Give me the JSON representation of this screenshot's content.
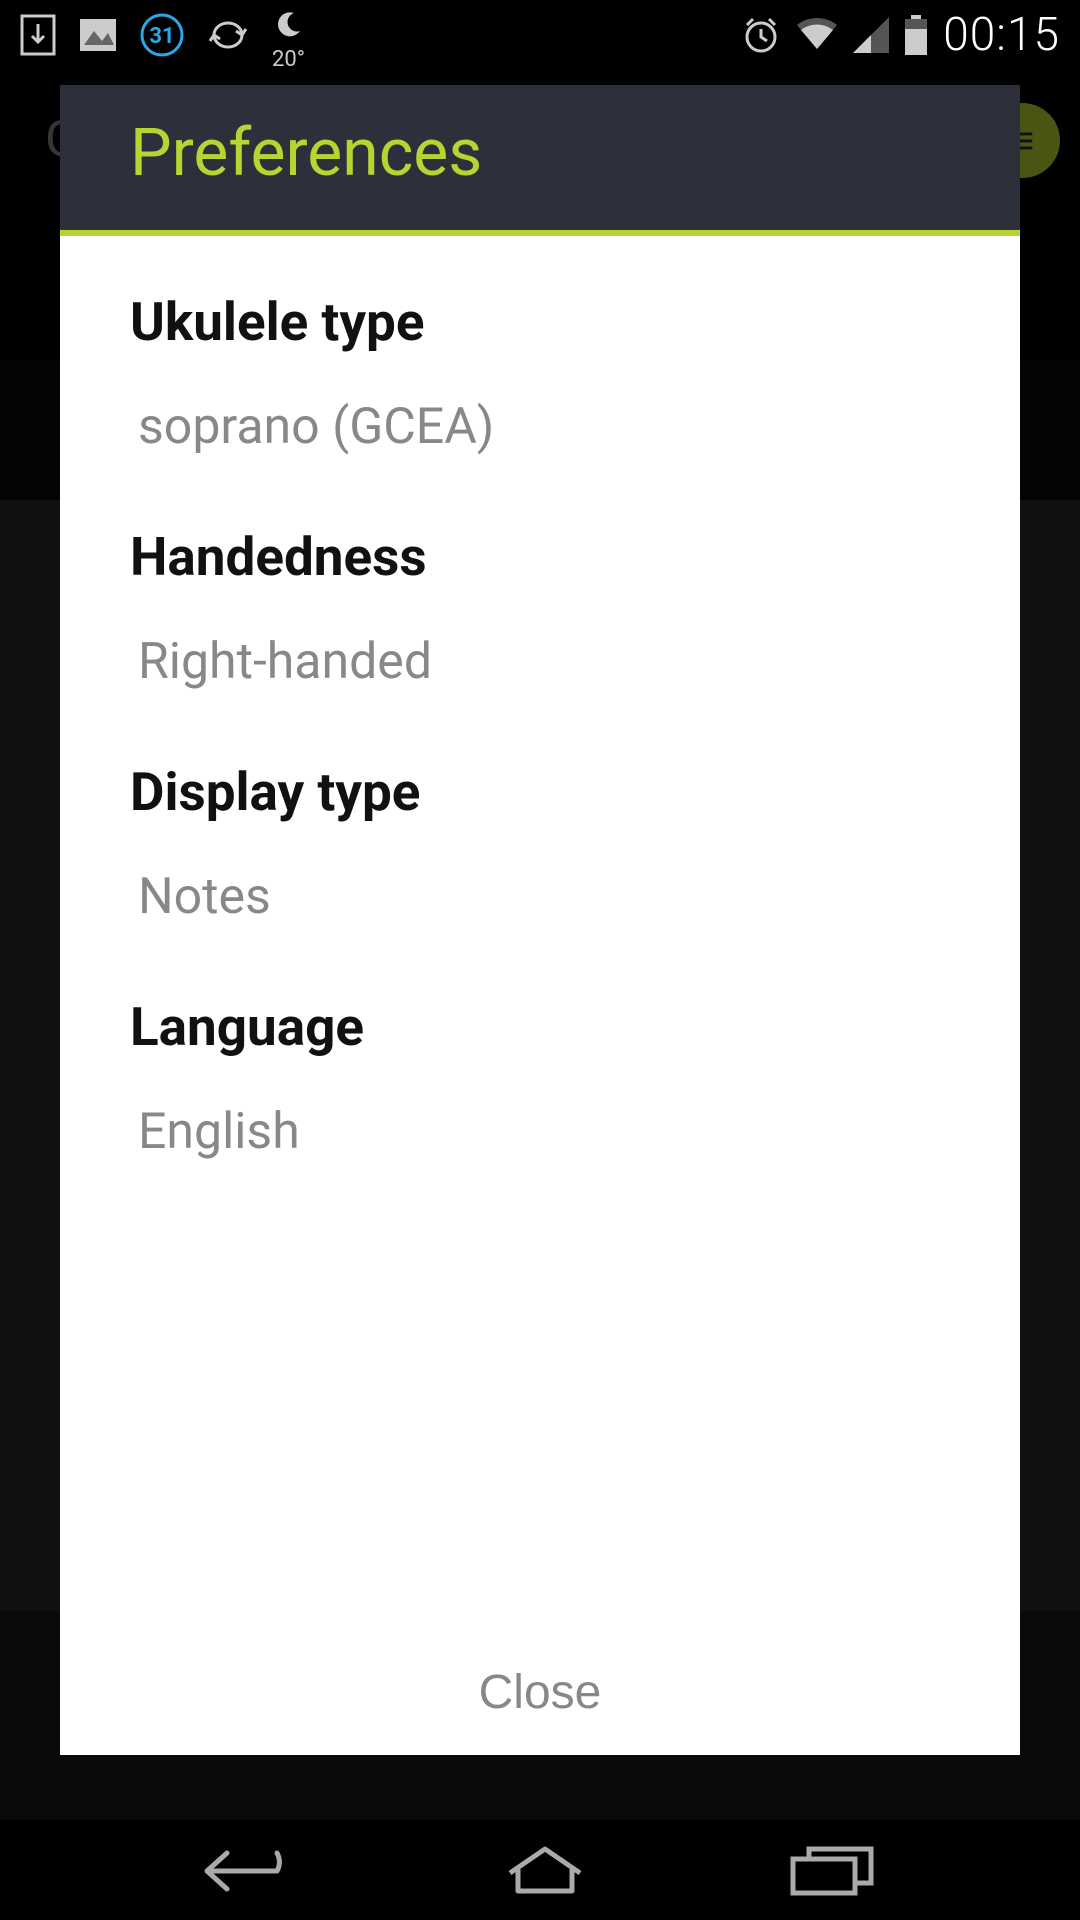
{
  "status_bar": {
    "calendar_day": "31",
    "temperature": "20°",
    "time": "00:15"
  },
  "app_background": {
    "header_text": "G"
  },
  "dialog": {
    "title": "Preferences",
    "items": [
      {
        "label": "Ukulele type",
        "value": "soprano (GCEA)"
      },
      {
        "label": "Handedness",
        "value": "Right-handed"
      },
      {
        "label": "Display type",
        "value": "Notes"
      },
      {
        "label": "Language",
        "value": "English"
      }
    ],
    "close_label": "Close"
  }
}
